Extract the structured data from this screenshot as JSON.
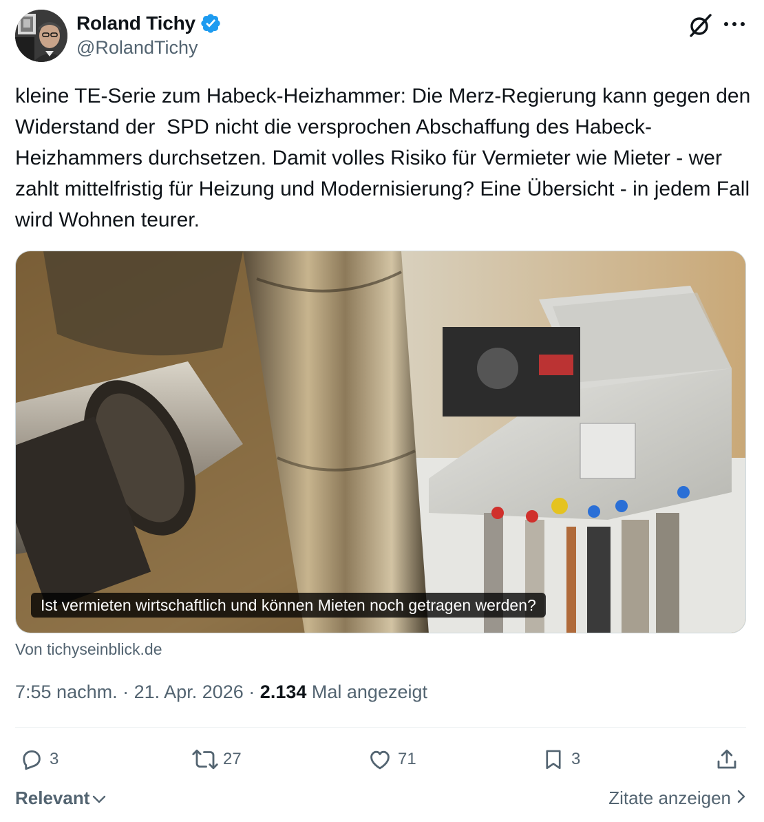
{
  "author": {
    "display_name": "Roland Tichy",
    "handle": "@RolandTichy",
    "verified_icon": "verified-badge-icon",
    "verified_color": "#1d9bf0"
  },
  "tweet": {
    "text": "kleine TE-Serie zum Habeck-Heizhammer: Die Merz-Regierung kann gegen den Widerstand der  SPD nicht die versprochen Abschaffung des Habeck-Heizhammers durchsetzen. Damit volles Risiko für Vermieter wie Mieter - wer zahlt mittelfristig für Heizung und Modernisierung? Eine Übersicht - in jedem Fall wird Wohnen teurer."
  },
  "card": {
    "caption": "Ist vermieten wirtschaftlich und können Mieten noch getragen werden?",
    "source": "Von tichyseinblick.de"
  },
  "meta": {
    "time": "7:55 nachm.",
    "separator": "·",
    "date": "21. Apr. 2026",
    "views_count": "2.134",
    "views_label": "Mal angezeigt"
  },
  "actions": {
    "replies": "3",
    "reposts": "27",
    "likes": "71",
    "bookmarks": "3"
  },
  "footer": {
    "sort_label": "Relevant",
    "quotes_label": "Zitate anzeigen"
  },
  "colors": {
    "text_primary": "#0f1419",
    "text_secondary": "#536471",
    "divider": "#eff3f4",
    "accent": "#1d9bf0"
  }
}
